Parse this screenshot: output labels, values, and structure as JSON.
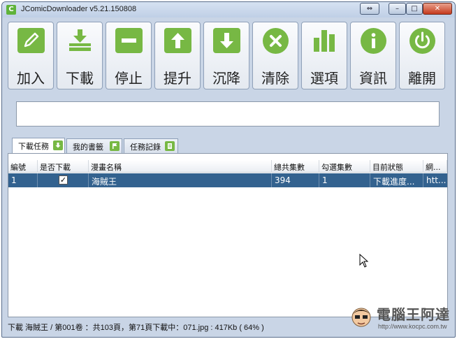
{
  "window": {
    "title": "JComicDownloader v5.21.150808"
  },
  "toolbar": {
    "buttons": [
      {
        "label": "加入",
        "icon": "pencil-icon"
      },
      {
        "label": "下載",
        "icon": "download-icon"
      },
      {
        "label": "停止",
        "icon": "minus-icon"
      },
      {
        "label": "提升",
        "icon": "arrow-up-icon"
      },
      {
        "label": "沉降",
        "icon": "arrow-down-icon"
      },
      {
        "label": "清除",
        "icon": "x-circle-icon"
      },
      {
        "label": "選項",
        "icon": "bar-chart-icon"
      },
      {
        "label": "資訊",
        "icon": "info-icon"
      },
      {
        "label": "離開",
        "icon": "power-icon"
      }
    ]
  },
  "url_input": {
    "value": ""
  },
  "tabs": [
    {
      "label": "下載任務",
      "icon": "download-tab-icon"
    },
    {
      "label": "我的書籤",
      "icon": "flag-tab-icon"
    },
    {
      "label": "任務記錄",
      "icon": "list-tab-icon"
    }
  ],
  "table": {
    "columns": [
      "編號",
      "是否下載",
      "漫畫名稱",
      "總共集數",
      "勾選集數",
      "目前狀態",
      "網..."
    ],
    "rows": [
      {
        "id": "1",
        "download": true,
        "name": "海賊王",
        "total": "394",
        "selected": "1",
        "status": "下載進度...",
        "url": "htt..."
      }
    ]
  },
  "status": {
    "text": "下載 海賊王 / 第001卷 ：共103頁，第71頁下載中：071.jpg : 417Kb ( 64% )"
  },
  "watermark": {
    "title": "電腦王阿達",
    "url": "http://www.kocpc.com.tw"
  },
  "colors": {
    "accent": "#77b844",
    "selection": "#33628f",
    "window": "#c9d5e6"
  }
}
